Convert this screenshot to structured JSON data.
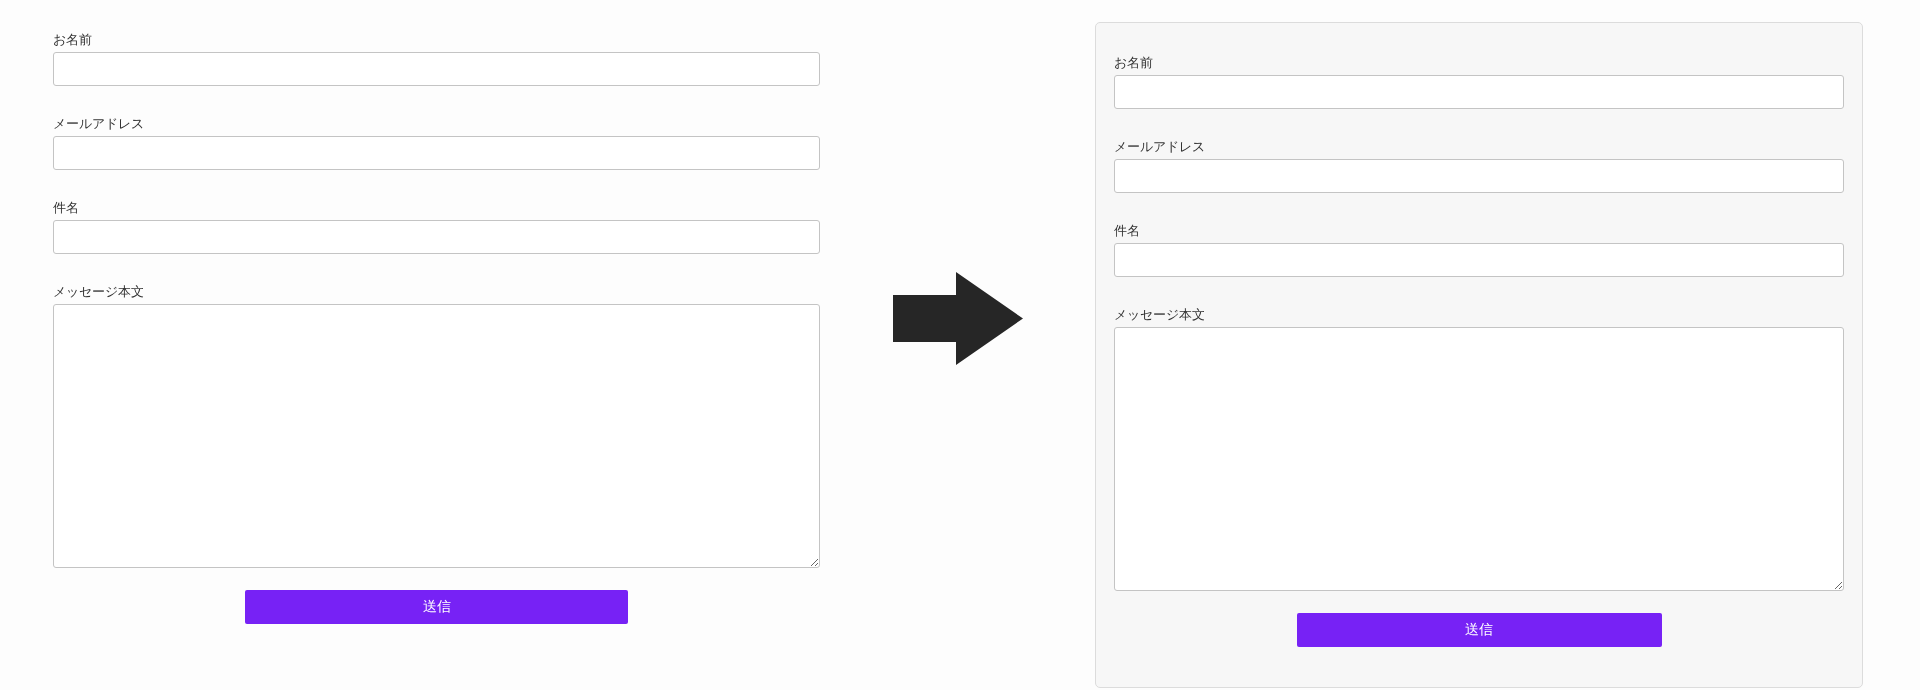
{
  "forms": [
    {
      "framed": false,
      "fields": [
        {
          "label": "お名前",
          "kind": "input"
        },
        {
          "label": "メールアドレス",
          "kind": "input"
        },
        {
          "label": "件名",
          "kind": "input"
        },
        {
          "label": "メッセージ本文",
          "kind": "textarea"
        }
      ],
      "submit": "送信"
    },
    {
      "framed": true,
      "fields": [
        {
          "label": "お名前",
          "kind": "input"
        },
        {
          "label": "メールアドレス",
          "kind": "input"
        },
        {
          "label": "件名",
          "kind": "input"
        },
        {
          "label": "メッセージ本文",
          "kind": "textarea"
        }
      ],
      "submit": "送信"
    }
  ]
}
